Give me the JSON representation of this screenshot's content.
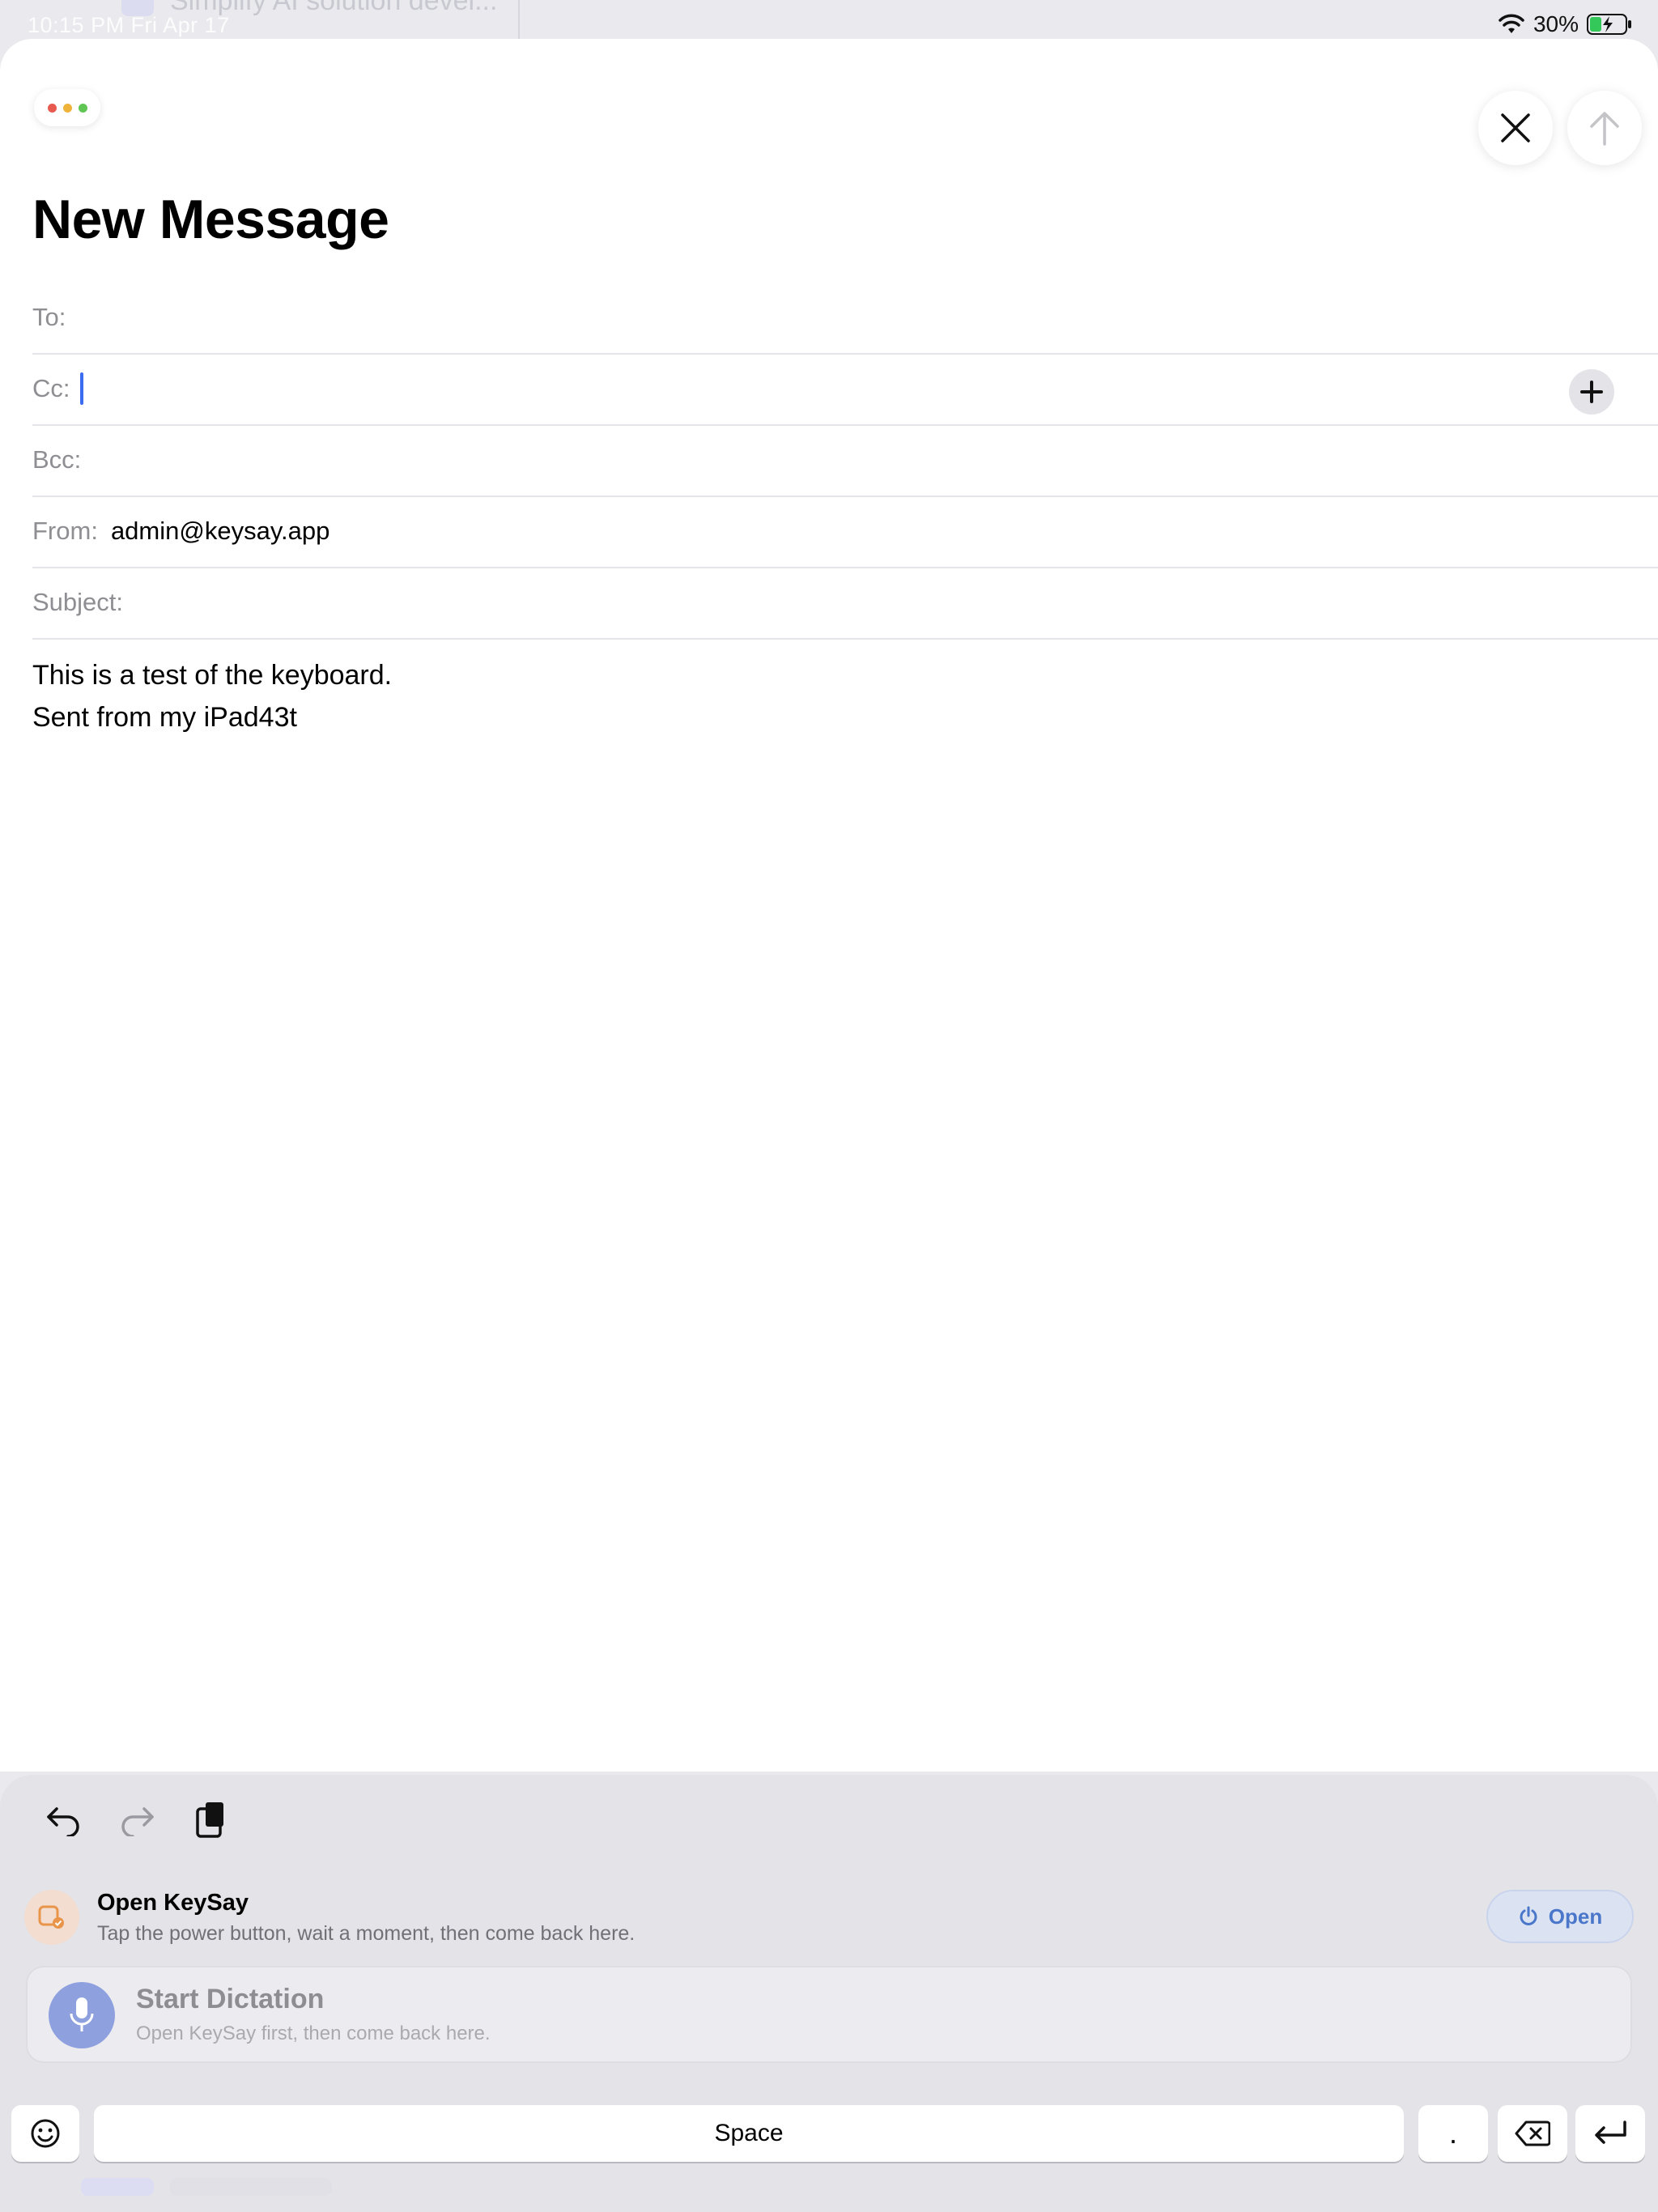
{
  "status_bar": {
    "time": "10:15 PM  Fri Apr 17",
    "battery_percent": "30%"
  },
  "background": {
    "ghost_text": "Simplify AI solution devel..."
  },
  "compose": {
    "title": "New Message",
    "fields": {
      "to_label": "To:",
      "cc_label": "Cc:",
      "bcc_label": "Bcc:",
      "from_label": "From:",
      "from_value": "admin@keysay.app",
      "subject_label": "Subject:"
    },
    "body_lines": [
      "This is a test of the keyboard.",
      "Sent from my iPad43t"
    ]
  },
  "keyboard": {
    "keysay": {
      "title": "Open KeySay",
      "subtitle": "Tap the power button, wait a moment, then come back here.",
      "open_label": "Open"
    },
    "dictation": {
      "title": "Start Dictation",
      "subtitle": "Open KeySay first, then come back here."
    },
    "keys": {
      "space": "Space",
      "period": "."
    }
  },
  "colors": {
    "accent": "#4a77c9",
    "caret": "#3a6df0",
    "traffic_red": "#e8594f",
    "traffic_yellow": "#efb33b",
    "traffic_green": "#5fc553"
  }
}
